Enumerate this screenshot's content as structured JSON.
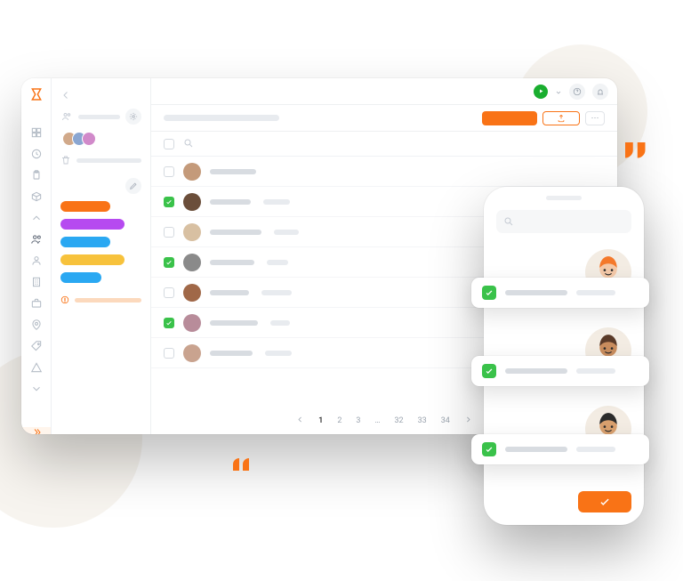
{
  "brand": {
    "accent": "#f97316",
    "success": "#3ac24a"
  },
  "rail_icons": [
    "dashboard-icon",
    "clock-icon",
    "clipboard-icon",
    "box-icon",
    "chevron-up-icon",
    "users-icon",
    "user-icon",
    "building-icon",
    "briefcase-icon",
    "pin-icon",
    "tag-icon",
    "triangle-icon",
    "chevron-down-icon"
  ],
  "rail_active": "users-icon",
  "sidebar": {
    "avatar_count": 3,
    "tags": [
      {
        "color": "#f97316",
        "size": "short"
      },
      {
        "color": "#b64af0",
        "size": "full"
      },
      {
        "color": "#2aa8f2",
        "size": "short"
      },
      {
        "color": "#f7c23c",
        "size": "full"
      },
      {
        "color": "#2aa8f2",
        "size": "shorter"
      }
    ]
  },
  "toolbar": {
    "primary_label": "",
    "export_label": "",
    "more_label": "⋯"
  },
  "list": {
    "rows": [
      {
        "checked": false,
        "name_w": 52,
        "sub_w": 0,
        "avatar": "#c49a7a"
      },
      {
        "checked": true,
        "name_w": 46,
        "sub_w": 30,
        "avatar": "#6b4e3a"
      },
      {
        "checked": false,
        "name_w": 58,
        "sub_w": 28,
        "avatar": "#d8c0a2"
      },
      {
        "checked": true,
        "name_w": 50,
        "sub_w": 24,
        "avatar": "#8a8a8a"
      },
      {
        "checked": false,
        "name_w": 44,
        "sub_w": 34,
        "avatar": "#a06848"
      },
      {
        "checked": true,
        "name_w": 54,
        "sub_w": 22,
        "avatar": "#b88c9a"
      },
      {
        "checked": false,
        "name_w": 48,
        "sub_w": 30,
        "avatar": "#c9a38f"
      }
    ]
  },
  "pagination": {
    "current": "1",
    "pages": [
      "1",
      "2",
      "3",
      "…",
      "32",
      "33",
      "34"
    ]
  },
  "phone": {
    "search_placeholder": "",
    "contacts": [
      {
        "hair": "#f4792b",
        "skin": "#f4c9a8",
        "shirt": "#2d6fe0"
      },
      {
        "hair": "#5a3a28",
        "skin": "#c98d5e",
        "shirt": "#f4792b"
      },
      {
        "hair": "#2b2b2b",
        "skin": "#d9a06e",
        "shirt": "#ffffff"
      }
    ]
  }
}
